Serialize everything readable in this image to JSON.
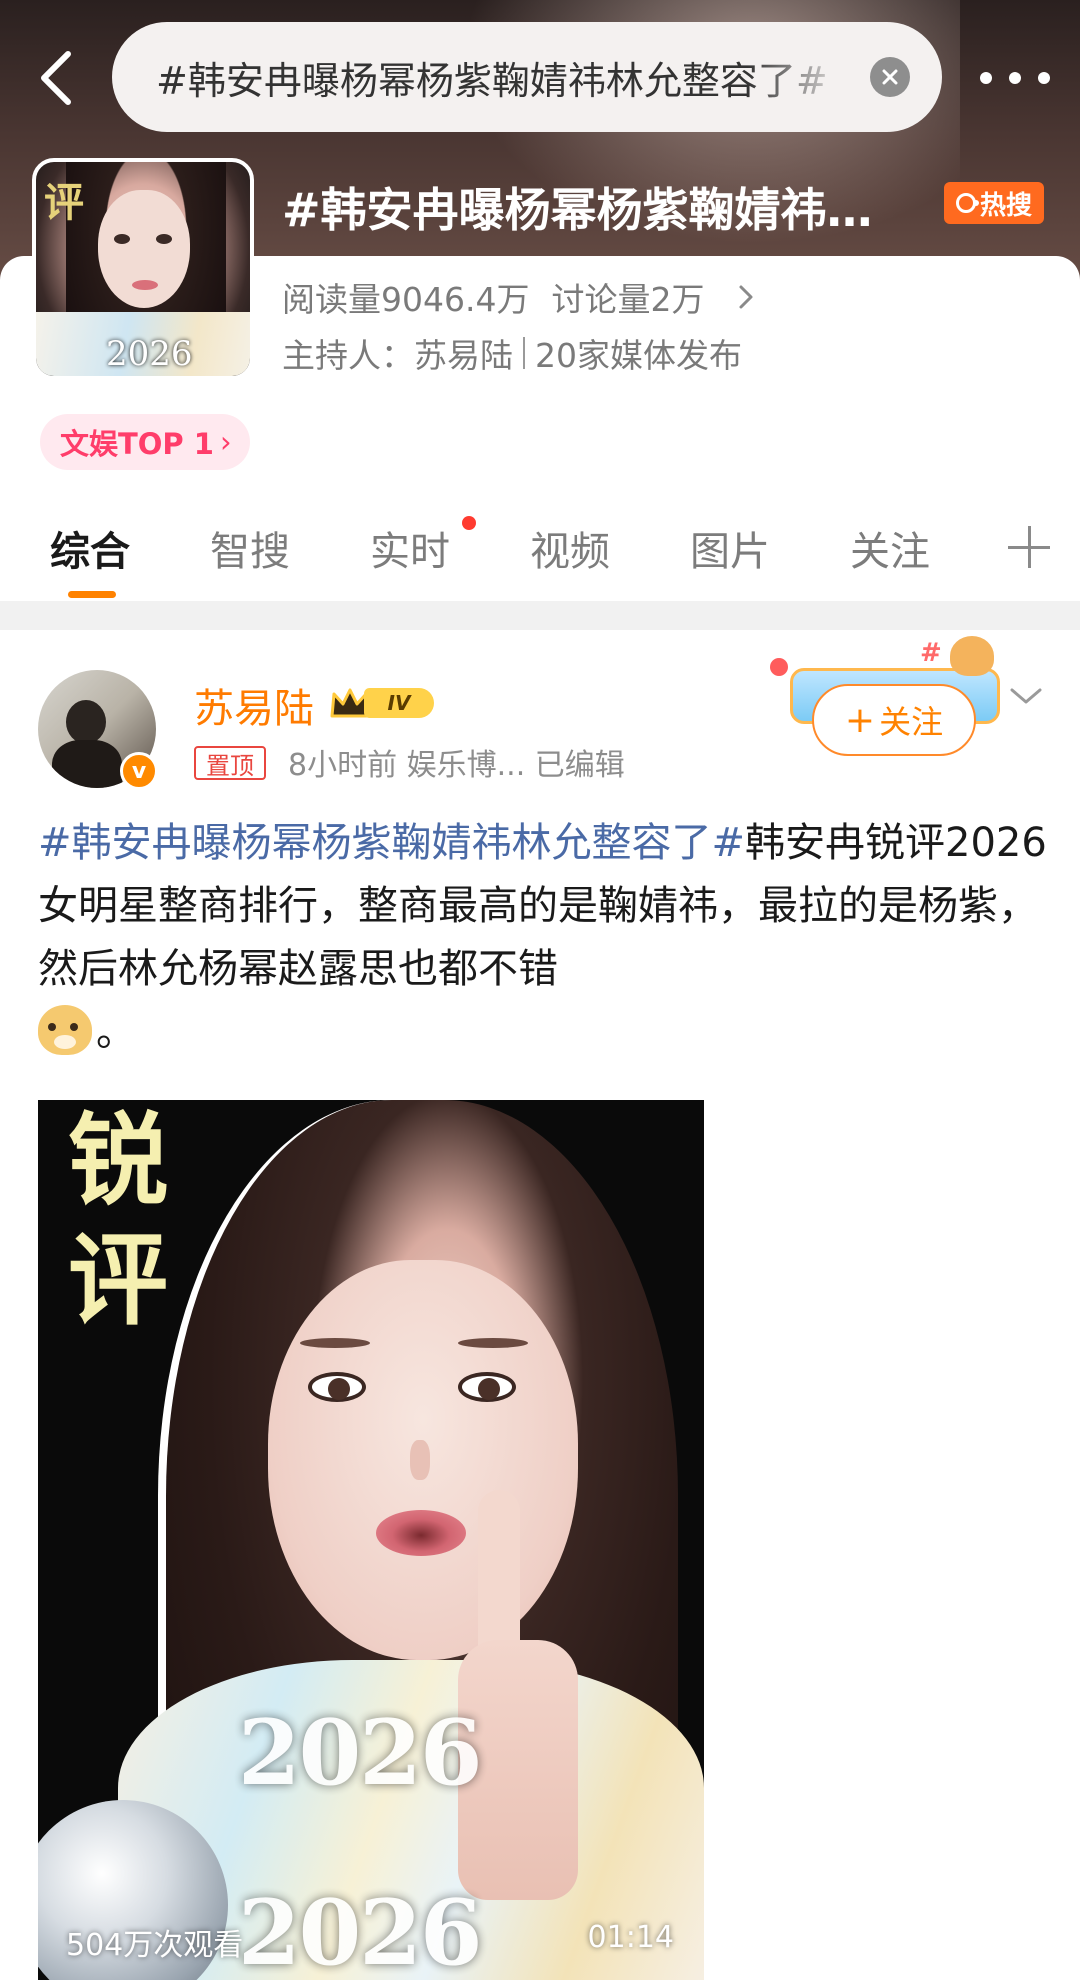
{
  "search": {
    "query": "#韩安冉曝杨幂杨紫鞠婧祎林允整容了#"
  },
  "topic": {
    "title": "#韩安冉曝杨幂杨紫鞠婧祎林允整容了#",
    "hot_label": "热搜",
    "read_label": "阅读量",
    "read_count": "9046.4万",
    "discuss_label": "讨论量",
    "discuss_count": "2万",
    "host_label": "主持人：",
    "host_name": "苏易陆",
    "media_count": "20家媒体发布",
    "rank_label": "文娱TOP 1",
    "thumb_char": "评",
    "thumb_year": "2026",
    "accent_color": "#ff6a1f"
  },
  "tabs": [
    {
      "label": "综合",
      "active": true
    },
    {
      "label": "智搜",
      "active": false
    },
    {
      "label": "实时",
      "active": false,
      "dot": true
    },
    {
      "label": "视频",
      "active": false
    },
    {
      "label": "图片",
      "active": false
    },
    {
      "label": "关注",
      "active": false
    }
  ],
  "post": {
    "author": "苏易陆",
    "level": "IV",
    "verified_badge": "v",
    "pinned_label": "置顶",
    "time": "8小时前",
    "source": "娱乐博...",
    "edited": "已编辑",
    "follow_label": "关注",
    "tag_text": "#韩安冉曝杨幂杨紫鞠婧祎林允整容了#",
    "body_text": "韩安冉锐评2026女明星整商排行，整商最高的是鞠婧祎，最拉的是杨紫，然后林允杨幂赵露思也都不错",
    "end_text": "。",
    "emoji": "doge-icon",
    "name_color": "#ff7b00",
    "tag_color": "#4a6aa6"
  },
  "video": {
    "overlay_chars": [
      "锐",
      "评"
    ],
    "overlay_years": [
      "2026",
      "2026"
    ],
    "views": "504万次观看",
    "duration": "01:14"
  }
}
